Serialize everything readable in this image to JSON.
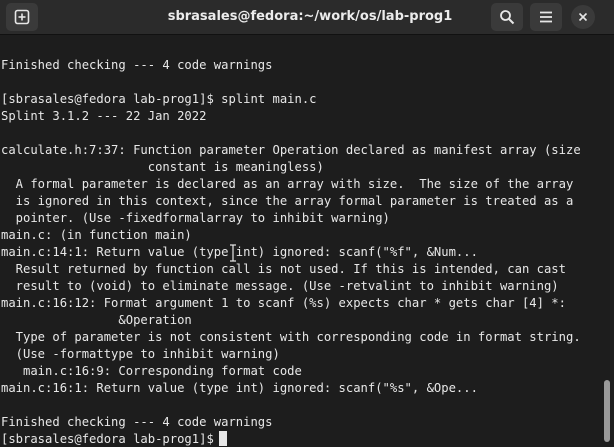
{
  "window": {
    "title": "sbrasales@fedora:~/work/os/lab-prog1"
  },
  "icons": {
    "new_tab": "new-tab-icon",
    "search": "search-icon",
    "menu": "hamburger-menu-icon",
    "close": "close-icon"
  },
  "terminal": {
    "lines": [
      "Finished checking --- 4 code warnings",
      "",
      "[sbrasales@fedora lab-prog1]$ splint main.c",
      "Splint 3.1.2 --- 22 Jan 2022",
      "",
      "calculate.h:7:37: Function parameter Operation declared as manifest array (size",
      "                    constant is meaningless)",
      "  A formal parameter is declared as an array with size.  The size of the array",
      "  is ignored in this context, since the array formal parameter is treated as a",
      "  pointer. (Use -fixedformalarray to inhibit warning)",
      "main.c: (in function main)",
      "main.c:14:1: Return value (type int) ignored: scanf(\"%f\", &Num...",
      "  Result returned by function call is not used. If this is intended, can cast",
      "  result to (void) to eliminate message. (Use -retvalint to inhibit warning)",
      "main.c:16:12: Format argument 1 to scanf (%s) expects char * gets char [4] *:",
      "                &Operation",
      "  Type of parameter is not consistent with corresponding code in format string.",
      "  (Use -formattype to inhibit warning)",
      "   main.c:16:9: Corresponding format code",
      "main.c:16:1: Return value (type int) ignored: scanf(\"%s\", &Ope...",
      "",
      "Finished checking --- 4 code warnings",
      "[sbrasales@fedora lab-prog1]$ "
    ]
  }
}
